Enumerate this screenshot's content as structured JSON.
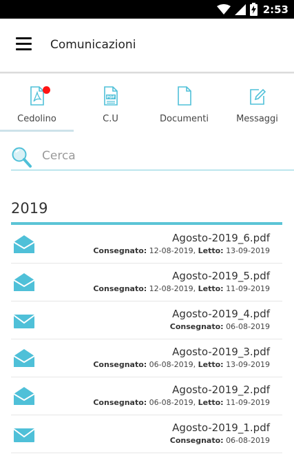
{
  "statusbar": {
    "time": "2:53",
    "icons": [
      "wifi-icon",
      "cellular-icon",
      "battery-charging-icon"
    ]
  },
  "appbar": {
    "title": "Comunicazioni",
    "menu_icon": "hamburger-menu-icon"
  },
  "tabs": [
    {
      "label": "Cedolino",
      "icon": "pdf-document-icon",
      "has_badge": true,
      "selected": true
    },
    {
      "label": "C.U",
      "icon": "pdf-file-icon",
      "has_badge": false,
      "selected": false
    },
    {
      "label": "Documenti",
      "icon": "document-icon",
      "has_badge": false,
      "selected": false
    },
    {
      "label": "Messaggi",
      "icon": "edit-message-icon",
      "has_badge": false,
      "selected": false
    }
  ],
  "search": {
    "placeholder": "Cerca",
    "value": "",
    "icon": "search-icon"
  },
  "year_header": "2019",
  "labels": {
    "delivered": "Consegnato:",
    "read": "Letto:"
  },
  "items": [
    {
      "filename": "Agosto-2019_6.pdf",
      "delivered": "12-08-2019",
      "read": "13-09-2019",
      "status": "read"
    },
    {
      "filename": "Agosto-2019_5.pdf",
      "delivered": "12-08-2019",
      "read": "11-09-2019",
      "status": "read"
    },
    {
      "filename": "Agosto-2019_4.pdf",
      "delivered": "06-08-2019",
      "read": "",
      "status": "unread"
    },
    {
      "filename": "Agosto-2019_3.pdf",
      "delivered": "06-08-2019",
      "read": "13-09-2019",
      "status": "read"
    },
    {
      "filename": "Agosto-2019_2.pdf",
      "delivered": "06-08-2019",
      "read": "11-09-2019",
      "status": "read"
    },
    {
      "filename": "Agosto-2019_1.pdf",
      "delivered": "06-08-2019",
      "read": "",
      "status": "unread"
    }
  ],
  "colors": {
    "accent": "#5bc4d6",
    "badge": "#ff1414",
    "icon": "#4fc0d8",
    "statusbar": "#000000"
  }
}
